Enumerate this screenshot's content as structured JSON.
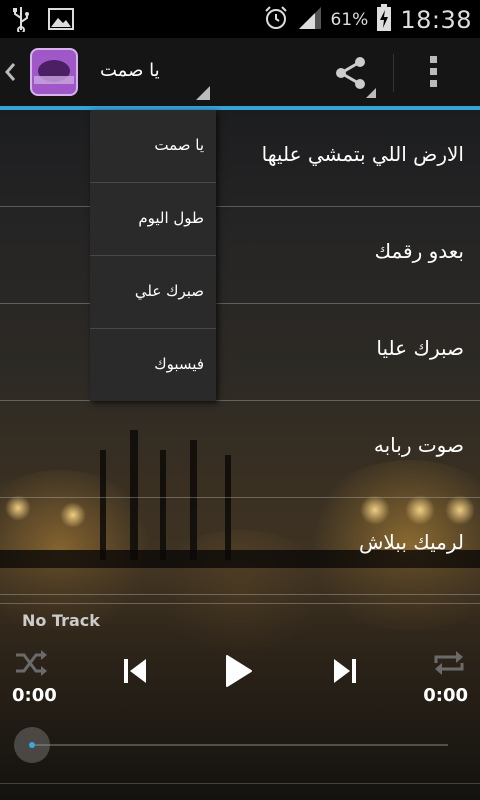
{
  "status_bar": {
    "battery_percent": "61%",
    "time": "18:38",
    "icons": [
      "usb-icon",
      "image-icon",
      "alarm-icon",
      "signal-icon",
      "battery-charging-icon"
    ]
  },
  "action_bar": {
    "title": "يا صمت",
    "icons": [
      "back-chevron-icon",
      "app-logo",
      "share-icon",
      "overflow-menu-icon"
    ],
    "accent_color": "#35a4d9"
  },
  "tracks": [
    {
      "title": "الارض اللي بتمشي عليها"
    },
    {
      "title": "بعدو رقمك"
    },
    {
      "title": "صبرك عليا"
    },
    {
      "title": "صوت ربابه"
    },
    {
      "title": "لرميك ببلاش"
    }
  ],
  "dropdown": {
    "items": [
      {
        "label": "يا صمت"
      },
      {
        "label": "طول اليوم"
      },
      {
        "label": "صبرك علي"
      },
      {
        "label": "فيسبوك"
      }
    ]
  },
  "player": {
    "now_playing": "No Track",
    "elapsed": "0:00",
    "duration": "0:00",
    "progress": 0,
    "icons": [
      "shuffle-icon",
      "previous-icon",
      "play-icon",
      "next-icon",
      "repeat-icon"
    ]
  }
}
